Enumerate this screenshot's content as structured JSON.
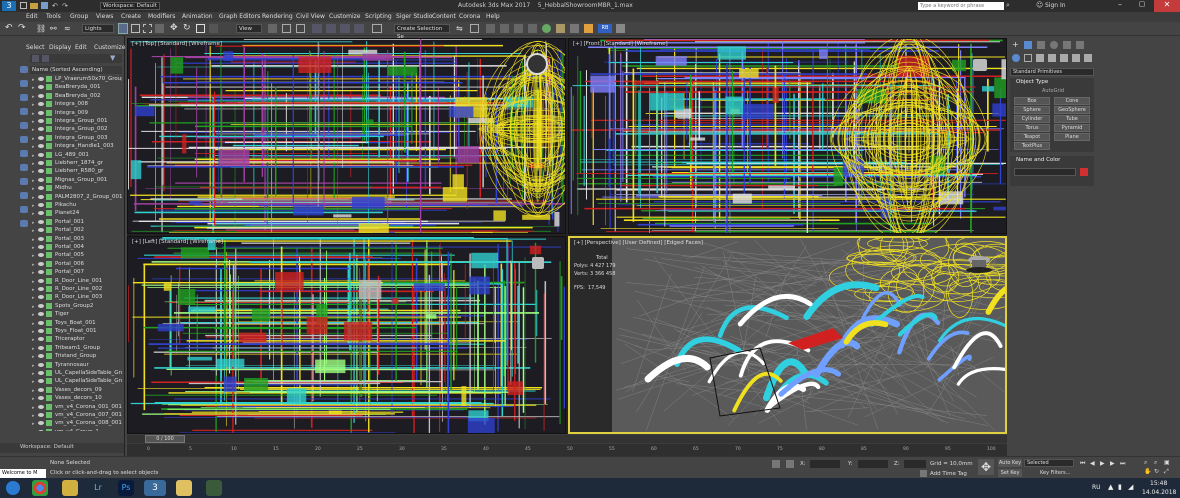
{
  "window": {
    "title": "Autodesk 3ds Max 2017    5_HebbalShowroomMBR_1.max",
    "workspace": "Workspace: Default",
    "search_placeholder": "Type a keyword or phrase",
    "sign_in": "Sign In"
  },
  "menu": [
    "Edit",
    "Tools",
    "Group",
    "Views",
    "Create",
    "Modifiers",
    "Animation",
    "Graph Editors",
    "Rendering",
    "Civil View",
    "Customize",
    "Scripting",
    "Siger Studio",
    "Content",
    "Corona",
    "Help"
  ],
  "toolbar": {
    "selection_filter": "Lights",
    "view_dropdown": "View",
    "create_selection_set": "Create Selection Se"
  },
  "explorer": {
    "tabs": [
      "Select",
      "Display",
      "Edit",
      "Customize"
    ],
    "sort_header": "Name (Sorted Ascending)",
    "items": [
      "LP_Vraerum50x70_Group",
      "BeaBreryda_001",
      "BeaBreryda_002",
      "Integra_008",
      "Integra_009",
      "Integra_Group_001",
      "Integra_Group_002",
      "Integra_Group_003",
      "Integra_Handle1_003",
      "LG_489_001",
      "Liebherr_1874_gr",
      "Liebherr_R580_gr",
      "Mignas_Group_001",
      "Midhu",
      "PALM2807_2_Group_001",
      "Pikachu",
      "Planet24",
      "Portal_001",
      "Portal_002",
      "Portal_003",
      "Portal_004",
      "Portal_005",
      "Portal_006",
      "Portal_007",
      "R_Door_Line_001",
      "R_Door_Line_002",
      "R_Door_Line_003",
      "Spots_Group2",
      "Tiger",
      "Toys_Boat_001",
      "Toys_Float_001",
      "Triceraptor",
      "Tribeam1_Group",
      "Tristand_Group",
      "Tyrannosaur",
      "UL_CapellaSideTable_Group",
      "UL_CapellaSideTable_Group",
      "Vases_decors_09",
      "Vases_decors_10",
      "vm_v4_Corona_001_001",
      "vm_v4_Corona_007_001",
      "vm_v4_Corona_008_001",
      "vm_v4_Group_1"
    ],
    "workspace_label": "Workspace: Default"
  },
  "viewports": {
    "top": "[+] [Top] [Standard] [Wireframe]",
    "front": "[+] [Front] [Standard] [Wireframe]",
    "left": "[+] [Left] [Standard] [Wireframe]",
    "perspective": "[+] [Perspective] [User Defined] [Edged Faces]"
  },
  "stats": {
    "total_label": "Total",
    "polys_label": "Polys:",
    "polys_value": "4 427 179",
    "verts_label": "Verts:",
    "verts_value": "3 366 458",
    "fps_label": "FPS:",
    "fps_value": "17,549"
  },
  "command_panel": {
    "dropdown": "Standard Primitives",
    "object_type": "Object Type",
    "autogrid": "AutoGrid",
    "buttons": [
      "Box",
      "Cone",
      "Sphere",
      "GeoSphere",
      "Cylinder",
      "Tube",
      "Torus",
      "Pyramid",
      "Teapot",
      "Plane",
      "TextPlus"
    ],
    "name_and_color": "Name and Color"
  },
  "timeline": {
    "frame": "0 / 100",
    "ticks": [
      "0",
      "5",
      "10",
      "15",
      "20",
      "25",
      "30",
      "35",
      "40",
      "45",
      "50",
      "55",
      "60",
      "65",
      "70",
      "75",
      "80",
      "85",
      "90",
      "95",
      "100"
    ]
  },
  "status": {
    "none_selected": "None Selected",
    "hint": "Click or click-and-drag to select objects",
    "x_label": "X:",
    "y_label": "Y:",
    "z_label": "Z:",
    "grid": "Grid = 10,0mm",
    "add_time_tag": "Add Time Tag",
    "auto_key": "Auto Key",
    "set_key": "Set Key",
    "selected": "Selected",
    "key_filters": "Key Filters...",
    "welcome": "Welcome to M"
  },
  "taskbar": {
    "lang": "RU",
    "time": "15:48",
    "date": "14.04.2018"
  },
  "colors": {
    "accent_yellow": "#f0e020",
    "wire_blue": "#3040d0",
    "wire_green": "#20a020",
    "wire_cyan": "#30d0d0",
    "wire_red": "#d02020",
    "highlight": "#e0d040"
  }
}
